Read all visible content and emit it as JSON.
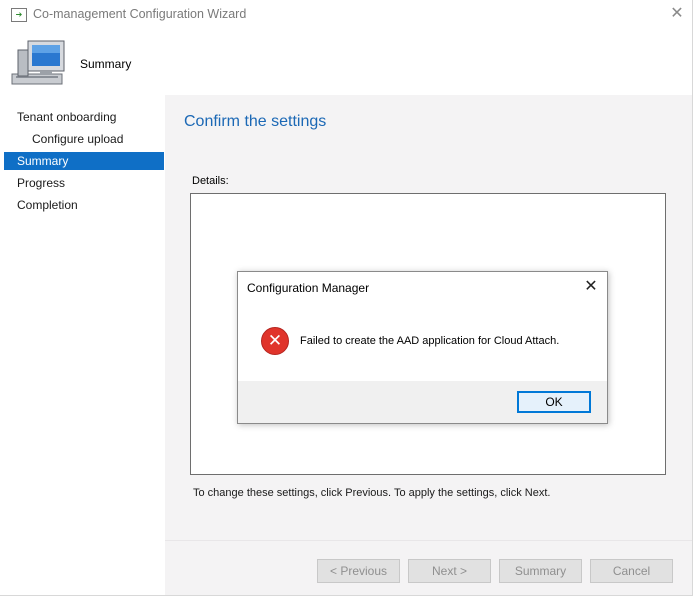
{
  "window": {
    "title": "Co-management Configuration Wizard",
    "close_glyph": "✕"
  },
  "header": {
    "title": "Summary",
    "icon": "computer-icon"
  },
  "sidebar": {
    "items": [
      {
        "label": "Tenant onboarding",
        "level": 0,
        "active": false
      },
      {
        "label": "Configure upload",
        "level": 1,
        "active": false
      },
      {
        "label": "Summary",
        "level": 0,
        "active": true
      },
      {
        "label": "Progress",
        "level": 0,
        "active": false
      },
      {
        "label": "Completion",
        "level": 0,
        "active": false
      }
    ]
  },
  "main": {
    "title": "Confirm the settings",
    "details_label": "Details:",
    "instructions": "To change these settings, click Previous. To apply the settings, click Next."
  },
  "footer": {
    "previous_label": "< Previous",
    "next_label": "Next >",
    "summary_label": "Summary",
    "cancel_label": "Cancel"
  },
  "dialog": {
    "title": "Configuration Manager",
    "close_glyph": "✕",
    "icon": "error-icon",
    "message": "Failed to create the AAD application for Cloud Attach.",
    "ok_label": "OK"
  },
  "colors": {
    "accent": "#0f6fc6",
    "title_blue": "#1b68b5",
    "content_bg": "#f4f3f4",
    "error_red": "#e0342b"
  }
}
